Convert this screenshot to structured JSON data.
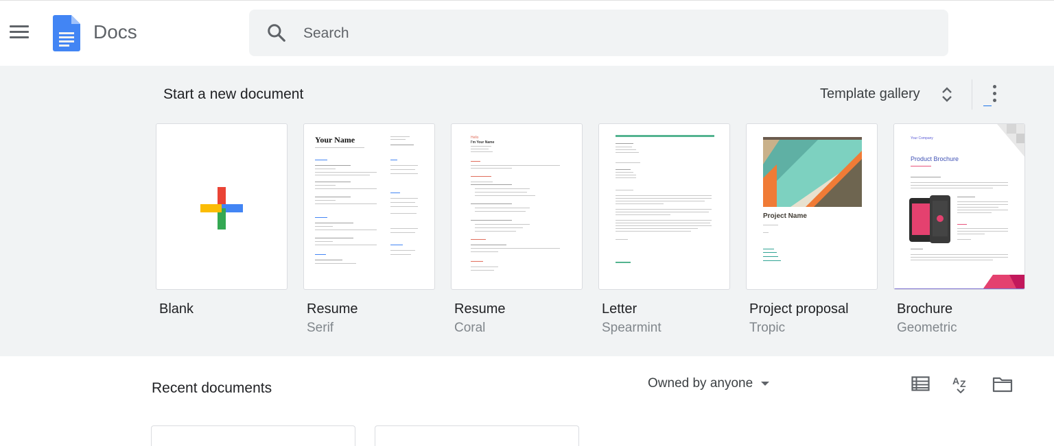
{
  "app": {
    "title": "Docs"
  },
  "search": {
    "placeholder": "Search"
  },
  "templates": {
    "section_title": "Start a new document",
    "gallery_label": "Template gallery",
    "items": [
      {
        "name": "Blank",
        "subtitle": ""
      },
      {
        "name": "Resume",
        "subtitle": "Serif",
        "thumb_heading": "Your Name"
      },
      {
        "name": "Resume",
        "subtitle": "Coral",
        "thumb_heading": "Hello",
        "thumb_heading2": "I'm Your Name"
      },
      {
        "name": "Letter",
        "subtitle": "Spearmint"
      },
      {
        "name": "Project proposal",
        "subtitle": "Tropic",
        "thumb_heading": "Project Name"
      },
      {
        "name": "Brochure",
        "subtitle": "Geometric",
        "thumb_heading": "Your Company",
        "thumb_heading2": "Product Brochure"
      }
    ]
  },
  "recent": {
    "title": "Recent documents",
    "owner_filter": "Owned by anyone"
  },
  "colors": {
    "google_blue": "#4285f4",
    "google_red": "#ea4335",
    "google_yellow": "#fbbc04",
    "google_green": "#34a853",
    "accent_blue": "#1a73e8"
  }
}
